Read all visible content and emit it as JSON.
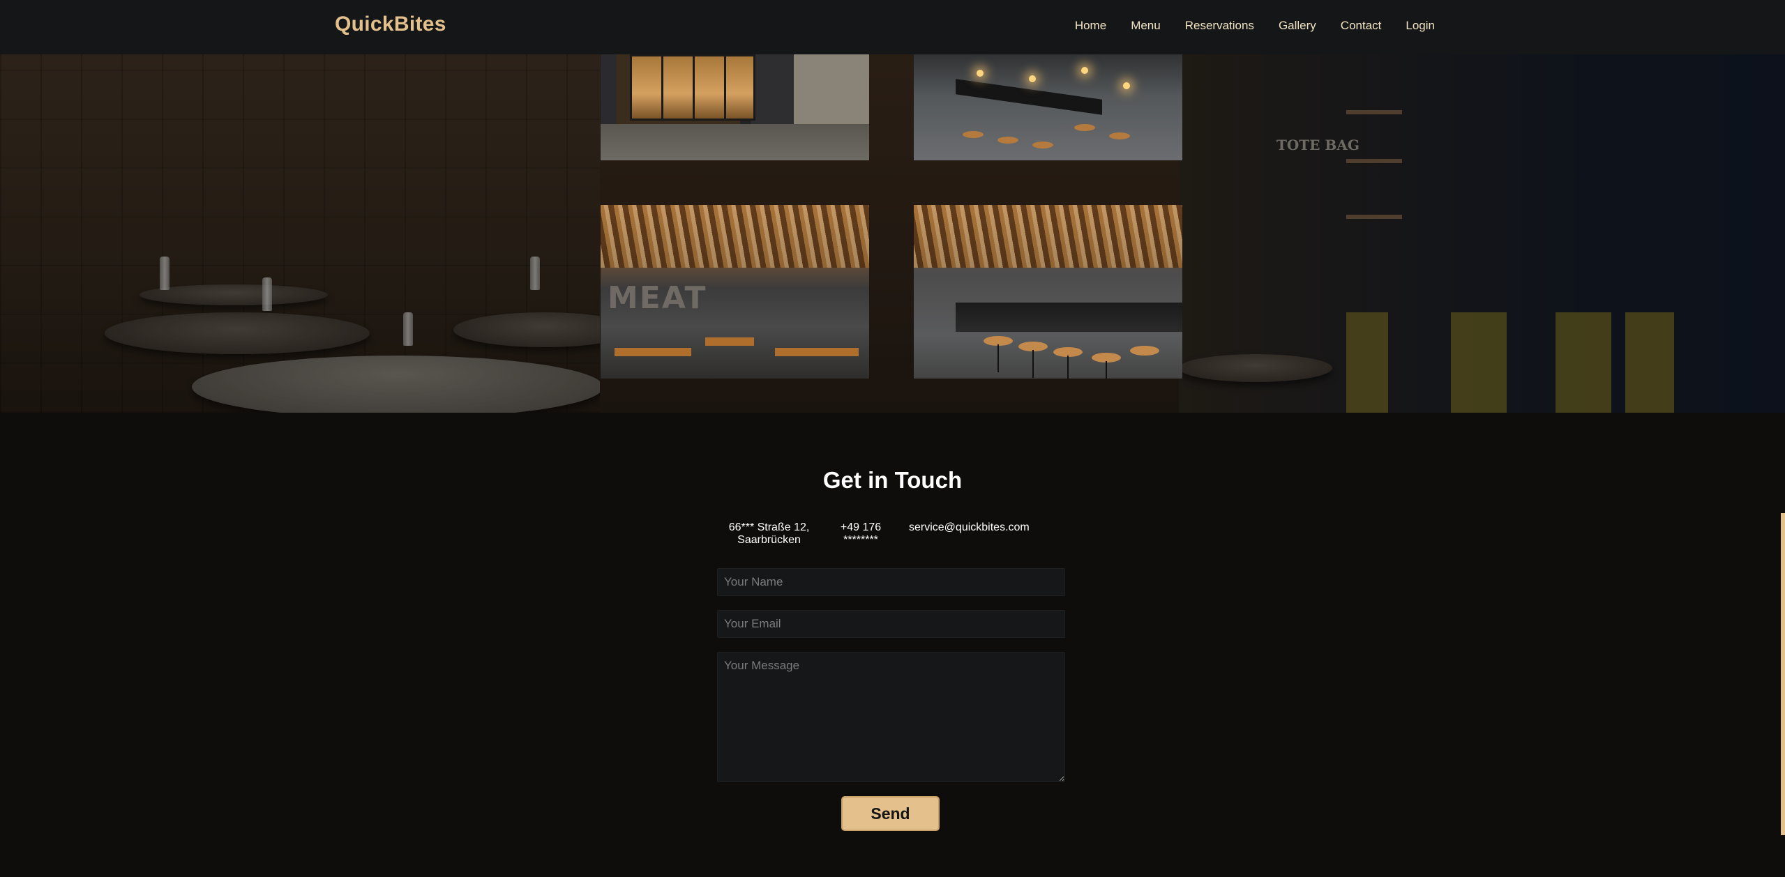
{
  "header": {
    "brand": "QuickBites",
    "nav": [
      {
        "label": "Home"
      },
      {
        "label": "Menu"
      },
      {
        "label": "Reservations"
      },
      {
        "label": "Gallery"
      },
      {
        "label": "Contact"
      },
      {
        "label": "Login"
      }
    ]
  },
  "hero": {
    "gallery": [
      {
        "alt": "restaurant-storefront-photo"
      },
      {
        "alt": "bar-counter-photo"
      },
      {
        "alt": "dining-room-wood-ceiling-photo",
        "sign_text": "MEAT"
      },
      {
        "alt": "bar-stools-wood-ceiling-photo"
      }
    ],
    "background_sign": "TOTE BAG"
  },
  "contact": {
    "title": "Get in Touch",
    "address": "66*** Straße 12, Saarbrücken",
    "phone": "+49 176 ********",
    "email": "service@quickbites.com",
    "name_placeholder": "Your Name",
    "email_placeholder": "Your Email",
    "message_placeholder": "Your Message",
    "send_label": "Send"
  },
  "colors": {
    "accent": "#e3c08c",
    "header_bg": "#151617",
    "page_bg": "#0e0d0c",
    "field_bg": "#161718"
  }
}
